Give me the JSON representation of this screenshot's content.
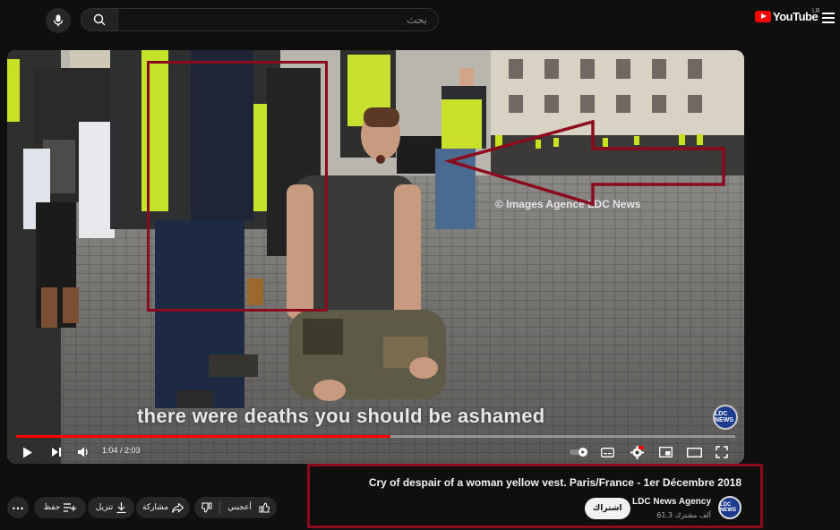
{
  "header": {
    "search_placeholder": "بحث",
    "logo_text": "YouTube",
    "logo_badge": "LB"
  },
  "video": {
    "caption": "there were deaths you should be ashamed",
    "watermark": "© Images Agence LDC News",
    "badge_text": "LDC NEWS",
    "current_time": "1:04",
    "duration": "2:03",
    "time_display": "1:04 / 2:03",
    "progress_fraction": 0.52
  },
  "info": {
    "title": "Cry of despair of a woman yellow vest. Paris/France - 1er Décembre 2018",
    "channel_name": "LDC News Agency",
    "subscribers": "61.3 ألف مشترك",
    "subscribe_label": "اشتراك",
    "avatar_text": "LDC NEWS"
  },
  "actions": {
    "like_label": "أعجبني",
    "share_label": "مشاركة",
    "download_label": "تنزيل",
    "save_label": "حفظ",
    "more_label": "..."
  },
  "colors": {
    "annotation_red": "#8b0a1c",
    "brand_red": "#ff0000",
    "background": "#0f0f0f"
  }
}
